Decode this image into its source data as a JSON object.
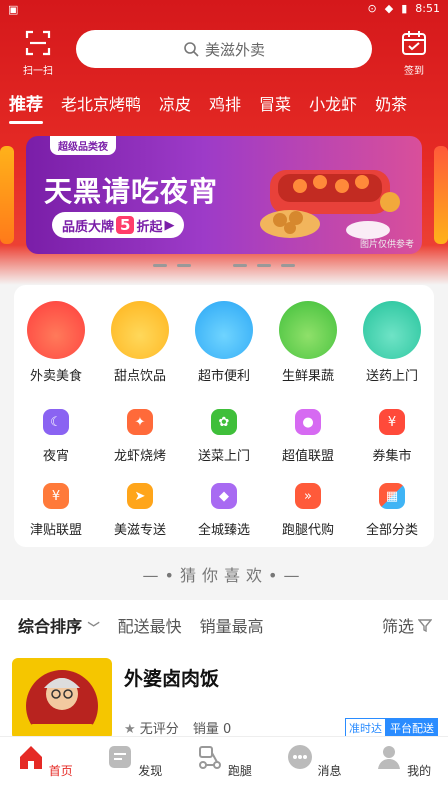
{
  "status_bar": {
    "left_icon": "notification-icon",
    "time": "8:51"
  },
  "header": {
    "scan_label": "扫一扫",
    "search_placeholder": "美滋外卖",
    "checkin_label": "签到"
  },
  "categories": [
    "推荐",
    "老北京烤鸭",
    "凉皮",
    "鸡排",
    "冒菜",
    "小龙虾",
    "奶茶"
  ],
  "banner": {
    "tag": "超级品类夜",
    "title": "天黑请吃夜宵",
    "pill_prefix": "品质大牌",
    "pill_number": "5",
    "pill_suffix": "折起",
    "credit": "图片仅供参考"
  },
  "services_main": [
    "外卖美食",
    "甜点饮品",
    "超市便利",
    "生鲜果蔬",
    "送药上门"
  ],
  "services_row2": [
    "夜宵",
    "龙虾烧烤",
    "送菜上门",
    "超值联盟",
    "券集市"
  ],
  "services_row3": [
    "津贴联盟",
    "美滋专送",
    "全城臻选",
    "跑腿代购",
    "全部分类"
  ],
  "guess_title": "猜你喜欢",
  "sort": {
    "items": [
      "综合排序",
      "配送最快",
      "销量最高"
    ],
    "filter": "筛选"
  },
  "store": {
    "name": "外婆卤肉饭",
    "rating": "无评分",
    "sales": "销量 0",
    "badge_1": "准时达",
    "badge_2": "平台配送",
    "thumb_text": "外婆卤肉饭"
  },
  "tabs": [
    "首页",
    "发现",
    "跑腿",
    "消息",
    "我的"
  ],
  "colors": {
    "brand": "#e52a25",
    "banner_purple": "#7a1ea8",
    "badge_blue": "#2a8cff"
  }
}
